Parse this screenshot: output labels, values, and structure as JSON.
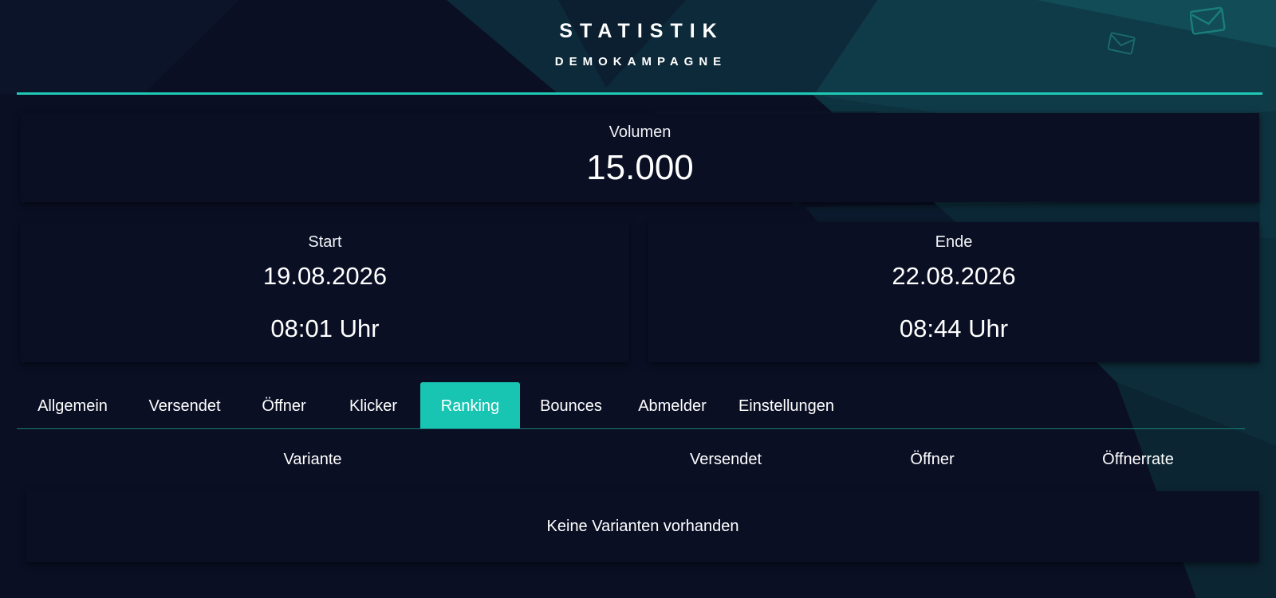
{
  "header": {
    "title": "STATISTIK",
    "subtitle": "DEMOKAMPAGNE"
  },
  "volume": {
    "label": "Volumen",
    "value": "15.000"
  },
  "start": {
    "label": "Start",
    "date": "19.08.2026",
    "time": "08:01 Uhr"
  },
  "end": {
    "label": "Ende",
    "date": "22.08.2026",
    "time": "08:44 Uhr"
  },
  "tabs": [
    {
      "label": "Allgemein"
    },
    {
      "label": "Versendet"
    },
    {
      "label": "Öffner"
    },
    {
      "label": "Klicker"
    },
    {
      "label": "Ranking",
      "active": true
    },
    {
      "label": "Bounces"
    },
    {
      "label": "Abmelder"
    },
    {
      "label": "Einstellungen"
    }
  ],
  "ranking_table": {
    "columns": [
      "Variante",
      "Versendet",
      "Öffner",
      "Öffnerrate"
    ],
    "empty_message": "Keine Varianten vorhanden"
  },
  "colors": {
    "accent": "#1fc9b5",
    "background": "#0a0f24"
  }
}
